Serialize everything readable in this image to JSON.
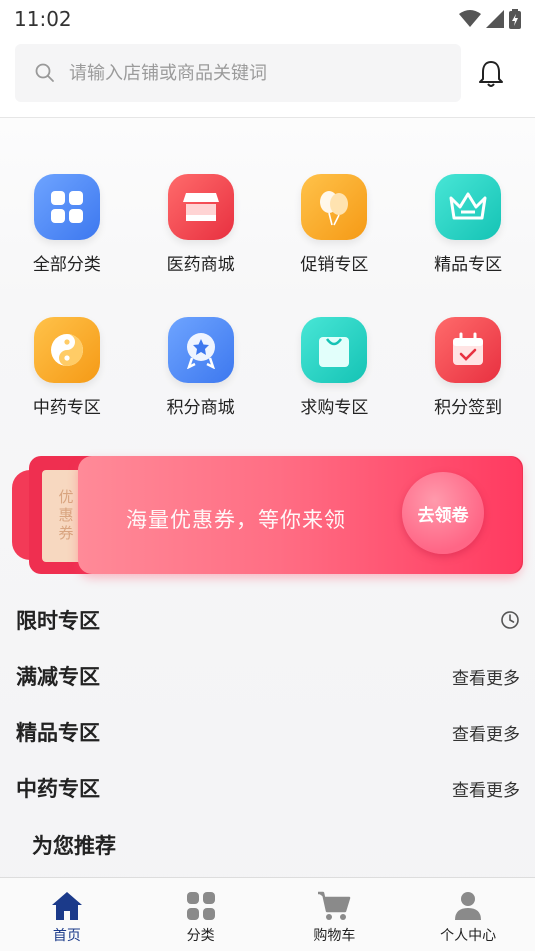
{
  "status_bar": {
    "time": "11:02"
  },
  "search": {
    "placeholder": "请输入店铺或商品关键词"
  },
  "categories": [
    {
      "label": "全部分类",
      "icon": "grid-icon",
      "color": "#4f8bf5"
    },
    {
      "label": "医药商城",
      "icon": "store-icon",
      "color": "#f2484f"
    },
    {
      "label": "促销专区",
      "icon": "balloons-icon",
      "color": "#f9a826"
    },
    {
      "label": "精品专区",
      "icon": "crown-icon",
      "color": "#22d3c5"
    },
    {
      "label": "中药专区",
      "icon": "yin-yang-icon",
      "color": "#f9a826"
    },
    {
      "label": "积分商城",
      "icon": "medal-icon",
      "color": "#4f8bf5"
    },
    {
      "label": "求购专区",
      "icon": "bag-icon",
      "color": "#22d3c5"
    },
    {
      "label": "积分签到",
      "icon": "calendar-check-icon",
      "color": "#f2484f"
    }
  ],
  "coupon_banner": {
    "ticket_text": "优惠券",
    "text": "海量优惠券，等你来领",
    "button_label": "去领卷"
  },
  "sections": [
    {
      "title": "限时专区",
      "more": ""
    },
    {
      "title": "满减专区",
      "more": "查看更多"
    },
    {
      "title": "精品专区",
      "more": "查看更多"
    },
    {
      "title": "中药专区",
      "more": "查看更多"
    }
  ],
  "recommend_title": "为您推荐",
  "tabbar": {
    "active_color": "#1b3a8a",
    "items": [
      {
        "label": "首页",
        "icon": "home-icon"
      },
      {
        "label": "分类",
        "icon": "category-grid-icon"
      },
      {
        "label": "购物车",
        "icon": "cart-icon"
      },
      {
        "label": "个人中心",
        "icon": "user-icon"
      }
    ]
  }
}
